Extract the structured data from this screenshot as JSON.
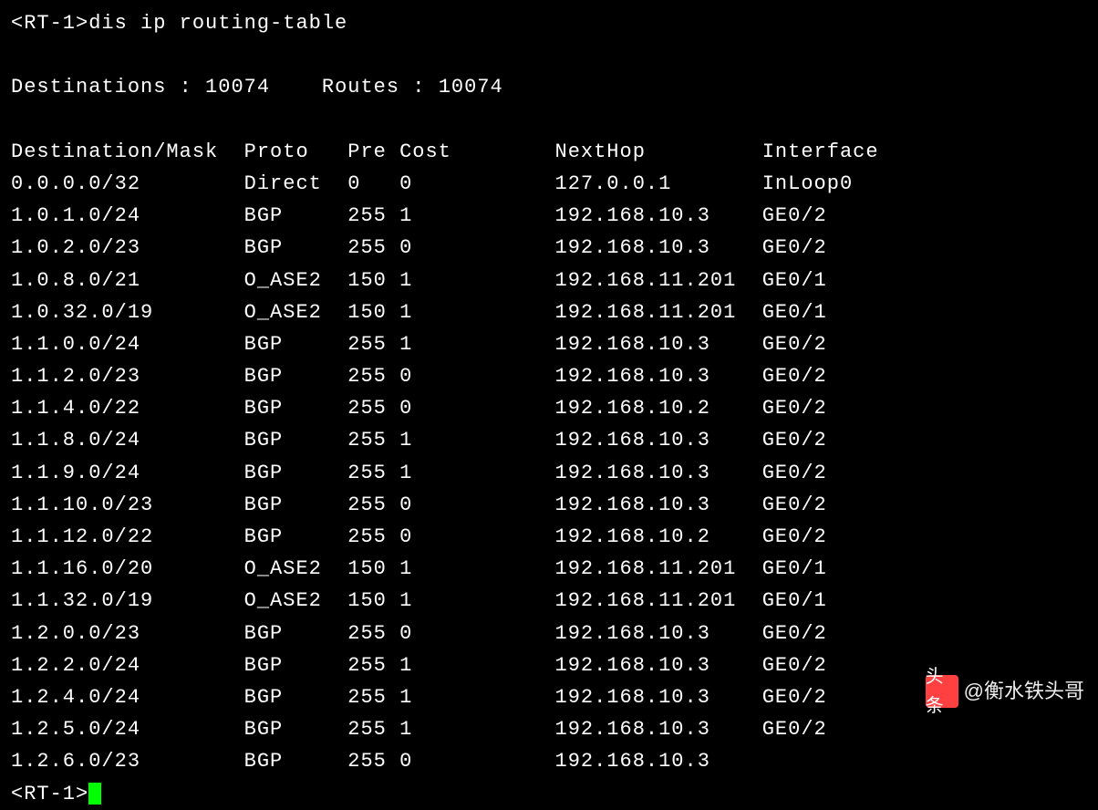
{
  "terminal": {
    "prompt": "<RT-1>",
    "command": "dis ip routing-table",
    "summary": {
      "destinations_label": "Destinations : ",
      "destinations_value": "10074",
      "routes_label": "Routes : ",
      "routes_value": "10074"
    },
    "headers": {
      "dest": "Destination/Mask",
      "proto": "Proto",
      "pre": "Pre",
      "cost": "Cost",
      "nexthop": "NextHop",
      "interface": "Interface"
    },
    "rows": [
      {
        "dest": "0.0.0.0/32",
        "proto": "Direct",
        "pre": "0",
        "cost": "0",
        "nexthop": "127.0.0.1",
        "interface": "InLoop0"
      },
      {
        "dest": "1.0.1.0/24",
        "proto": "BGP",
        "pre": "255",
        "cost": "1",
        "nexthop": "192.168.10.3",
        "interface": "GE0/2"
      },
      {
        "dest": "1.0.2.0/23",
        "proto": "BGP",
        "pre": "255",
        "cost": "0",
        "nexthop": "192.168.10.3",
        "interface": "GE0/2"
      },
      {
        "dest": "1.0.8.0/21",
        "proto": "O_ASE2",
        "pre": "150",
        "cost": "1",
        "nexthop": "192.168.11.201",
        "interface": "GE0/1"
      },
      {
        "dest": "1.0.32.0/19",
        "proto": "O_ASE2",
        "pre": "150",
        "cost": "1",
        "nexthop": "192.168.11.201",
        "interface": "GE0/1"
      },
      {
        "dest": "1.1.0.0/24",
        "proto": "BGP",
        "pre": "255",
        "cost": "1",
        "nexthop": "192.168.10.3",
        "interface": "GE0/2"
      },
      {
        "dest": "1.1.2.0/23",
        "proto": "BGP",
        "pre": "255",
        "cost": "0",
        "nexthop": "192.168.10.3",
        "interface": "GE0/2"
      },
      {
        "dest": "1.1.4.0/22",
        "proto": "BGP",
        "pre": "255",
        "cost": "0",
        "nexthop": "192.168.10.2",
        "interface": "GE0/2"
      },
      {
        "dest": "1.1.8.0/24",
        "proto": "BGP",
        "pre": "255",
        "cost": "1",
        "nexthop": "192.168.10.3",
        "interface": "GE0/2"
      },
      {
        "dest": "1.1.9.0/24",
        "proto": "BGP",
        "pre": "255",
        "cost": "1",
        "nexthop": "192.168.10.3",
        "interface": "GE0/2"
      },
      {
        "dest": "1.1.10.0/23",
        "proto": "BGP",
        "pre": "255",
        "cost": "0",
        "nexthop": "192.168.10.3",
        "interface": "GE0/2"
      },
      {
        "dest": "1.1.12.0/22",
        "proto": "BGP",
        "pre": "255",
        "cost": "0",
        "nexthop": "192.168.10.2",
        "interface": "GE0/2"
      },
      {
        "dest": "1.1.16.0/20",
        "proto": "O_ASE2",
        "pre": "150",
        "cost": "1",
        "nexthop": "192.168.11.201",
        "interface": "GE0/1"
      },
      {
        "dest": "1.1.32.0/19",
        "proto": "O_ASE2",
        "pre": "150",
        "cost": "1",
        "nexthop": "192.168.11.201",
        "interface": "GE0/1"
      },
      {
        "dest": "1.2.0.0/23",
        "proto": "BGP",
        "pre": "255",
        "cost": "0",
        "nexthop": "192.168.10.3",
        "interface": "GE0/2"
      },
      {
        "dest": "1.2.2.0/24",
        "proto": "BGP",
        "pre": "255",
        "cost": "1",
        "nexthop": "192.168.10.3",
        "interface": "GE0/2"
      },
      {
        "dest": "1.2.4.0/24",
        "proto": "BGP",
        "pre": "255",
        "cost": "1",
        "nexthop": "192.168.10.3",
        "interface": "GE0/2"
      },
      {
        "dest": "1.2.5.0/24",
        "proto": "BGP",
        "pre": "255",
        "cost": "1",
        "nexthop": "192.168.10.3",
        "interface": "GE0/2"
      },
      {
        "dest": "1.2.6.0/23",
        "proto": "BGP",
        "pre": "255",
        "cost": "0",
        "nexthop": "192.168.10.3",
        "interface": ""
      }
    ]
  },
  "watermark": {
    "logo": "头条",
    "text": "@衡水铁头哥"
  }
}
